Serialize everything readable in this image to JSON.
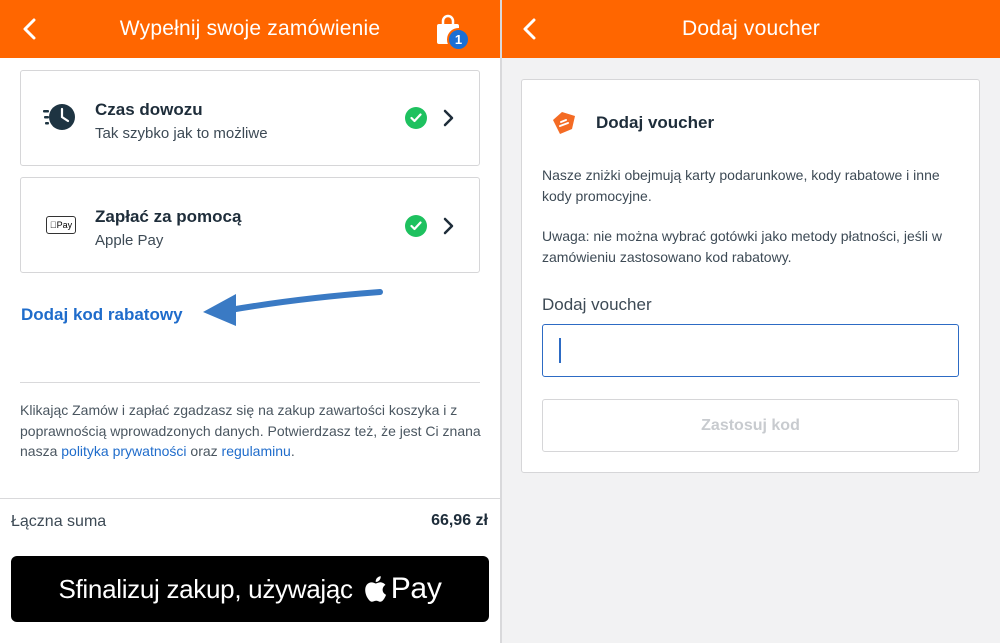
{
  "left": {
    "header": {
      "title": "Wypełnij swoje zamówienie",
      "cart_count": "1"
    },
    "delivery": {
      "title": "Czas dowozu",
      "subtitle": "Tak szybko jak to możliwe"
    },
    "payment": {
      "title": "Zapłać za pomocą",
      "subtitle": "Apple Pay",
      "chip_label": "Pay"
    },
    "discount_link": "Dodaj kod rabatowy",
    "legal": {
      "text_1": "Klikając Zamów i zapłać zgadzasz się na zakup zawartości koszyka i z poprawnością wprowadzonych danych. Potwierdzasz też, że jest Ci znana nasza ",
      "privacy_link": "polityka prywatności",
      "text_2": " oraz ",
      "terms_link": "regulaminu",
      "text_3": "."
    },
    "total": {
      "label": "Łączna suma",
      "value": "66,96 zł"
    },
    "apple_pay_button": {
      "label": "Sfinalizuj zakup, używając",
      "pay": "Pay"
    }
  },
  "right": {
    "header": {
      "title": "Dodaj voucher"
    },
    "card": {
      "title": "Dodaj voucher",
      "desc_1": "Nasze zniżki obejmują karty podarunkowe, kody rabatowe i inne kody promocyjne.",
      "desc_2": "Uwaga: nie można wybrać gotówki jako metody płatności, jeśli w zamówieniu zastosowano kod rabatowy.",
      "input_label": "Dodaj voucher",
      "input_value": "",
      "apply_button": "Zastosuj kod"
    }
  },
  "colors": {
    "brand_orange": "#ff6600",
    "link_blue": "#1f6ccb",
    "success_green": "#1ec15f",
    "badge_blue": "#1a6fd4",
    "annotation_arrow": "#3a7ac4"
  },
  "icons": [
    "back-chevron-icon",
    "shopping-bag-icon",
    "clock-icon",
    "apple-pay-icon",
    "check-circle-icon",
    "chevron-right-icon",
    "voucher-tag-icon",
    "apple-logo-icon"
  ]
}
